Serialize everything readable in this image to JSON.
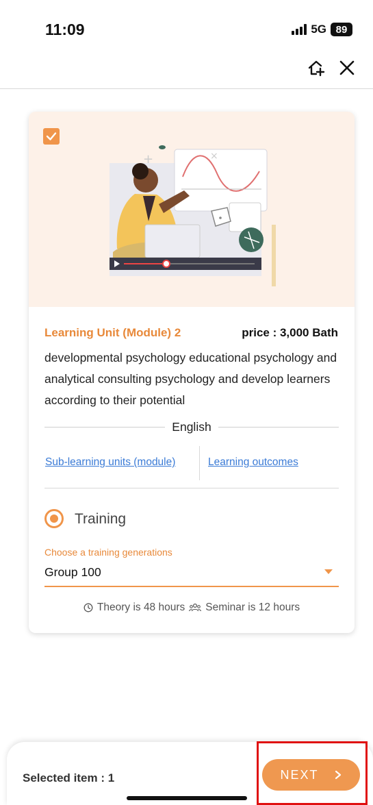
{
  "status_bar": {
    "time": "11:09",
    "network": "5G",
    "battery": "89"
  },
  "header": {
    "icons": [
      "add-home-icon",
      "close-icon"
    ]
  },
  "card": {
    "checked": true,
    "unit_title": "Learning Unit (Module) 2",
    "price": "price : 3,000 Bath",
    "description": "developmental psychology educational psychology and analytical consulting psychology and develop learners according to their potential",
    "language": "English",
    "links": {
      "sub_units": "Sub-learning units (module)",
      "outcomes": "Learning outcomes"
    },
    "training": {
      "label": "Training",
      "selected": true
    },
    "generation_select": {
      "label": "Choose a training generations",
      "value": "Group 100"
    },
    "hours": {
      "theory": "Theory is 48 hours",
      "seminar": "Seminar is 12 hours"
    }
  },
  "footer": {
    "selected_text": "Selected item : 1",
    "next_label": "NEXT"
  },
  "colors": {
    "accent": "#f0954a",
    "link": "#3b7bd6",
    "hero_bg": "#fdf1e8",
    "highlight": "#e01010"
  }
}
